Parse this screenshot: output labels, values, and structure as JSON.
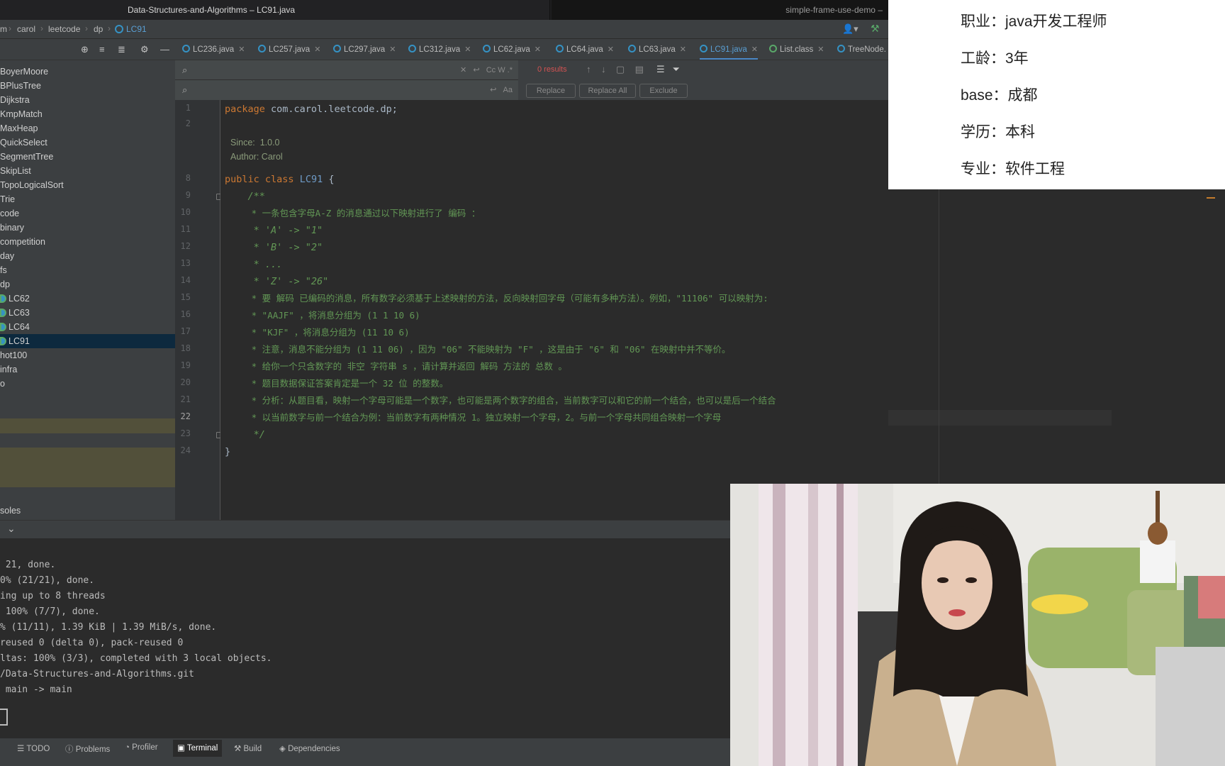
{
  "window": {
    "title_left": "Data-Structures-and-Algorithms – LC91.java",
    "title_right": "simple-frame-use-demo –"
  },
  "breadcrumb": [
    "m",
    "carol",
    "leetcode",
    "dp",
    "LC91"
  ],
  "tabs": [
    {
      "label": "LC236.java",
      "icon": "class-icon"
    },
    {
      "label": "LC257.java",
      "icon": "class-icon"
    },
    {
      "label": "LC297.java",
      "icon": "class-icon"
    },
    {
      "label": "LC312.java",
      "icon": "class-icon"
    },
    {
      "label": "LC62.java",
      "icon": "class-icon"
    },
    {
      "label": "LC64.java",
      "icon": "class-icon"
    },
    {
      "label": "LC63.java",
      "icon": "class-icon"
    },
    {
      "label": "LC91.java",
      "icon": "class-icon",
      "active": true
    },
    {
      "label": "List.class",
      "icon": "interface-icon"
    },
    {
      "label": "TreeNode.",
      "icon": "class-icon"
    }
  ],
  "find": {
    "results": "0 results",
    "options": "Cc  W  .*",
    "replace_label": "Replace",
    "replace_all_label": "Replace All",
    "exclude_label": "Exclude"
  },
  "project_tree": [
    "BoyerMoore",
    "BPlusTree",
    "Dijkstra",
    "KmpMatch",
    "MaxHeap",
    "QuickSelect",
    "SegmentTree",
    "SkipList",
    "TopoLogicalSort",
    "Trie",
    "code",
    "binary",
    "competition",
    "day",
    "fs",
    "dp",
    "LC62",
    "LC63",
    "LC64",
    "LC91",
    "hot100",
    "infra",
    "o"
  ],
  "project_consoles": "soles",
  "line_numbers": [
    "1",
    "2",
    "8",
    "9",
    "10",
    "11",
    "12",
    "13",
    "14",
    "15",
    "16",
    "17",
    "18",
    "19",
    "20",
    "21",
    "22",
    "23",
    "24"
  ],
  "code": {
    "line1_kw": "package",
    "line1_rest": " com.carol.leetcode.dp;",
    "since_label": "Since:",
    "since_value": "1.0.0",
    "author_label": "Author:",
    "author_value": "Carol",
    "line8_kw1": "public",
    "line8_kw2": "class",
    "line8_cls": "LC91",
    "line8_brace": "{",
    "line9": "    /**",
    "line10": "     * 一条包含字母A-Z 的消息通过以下映射进行了 编码 ：",
    "line11": "     * 'A' -> \"1\"",
    "line12": "     * 'B' -> \"2\"",
    "line13": "     * ...",
    "line14": "     * 'Z' -> \"26\"",
    "line15": "     * 要 解码 已编码的消息，所有数字必须基于上述映射的方法，反向映射回字母（可能有多种方法）。例如，\"11106\" 可以映射为:",
    "line16": "     * \"AAJF\" ，将消息分组为 (1 1 10 6)",
    "line17": "     * \"KJF\" ，将消息分组为 (11 10 6)",
    "line18": "     * 注意，消息不能分组为 (1 11 06) ，因为 \"06\" 不能映射为 \"F\" ，这是由于 \"6\" 和 \"06\" 在映射中并不等价。",
    "line19": "     * 给你一个只含数字的 非空 字符串 s ，请计算并返回 解码 方法的 总数 。",
    "line20": "     * 题目数据保证答案肯定是一个 32 位 的整数。",
    "line21": "     * 分析：从题目看，映射一个字母可能是一个数字，也可能是两个数字的组合，当前数字可以和它的前一个结合，也可以是后一个结合",
    "line22": "     * 以当前数字与前一个结合为例：当前数字有两种情况 1。独立映射一个字母，2。与前一个字母共同组合映射一个字母",
    "line23": "     */",
    "line24": "}"
  },
  "terminal": {
    "lines": [
      " 21, done.",
      "0% (21/21), done.",
      "ing up to 8 threads",
      " 100% (7/7), done.",
      "% (11/11), 1.39 KiB | 1.39 MiB/s, done.",
      "reused 0 (delta 0), pack-reused 0",
      "ltas: 100% (3/3), completed with 3 local objects.",
      "/Data-Structures-and-Algorithms.git",
      " main -> main"
    ]
  },
  "statusbar": {
    "todo": "TODO",
    "problems": "Problems",
    "profiler": "Profiler",
    "terminal": "Terminal",
    "build": "Build",
    "dependencies": "Dependencies"
  },
  "info_card": {
    "job": "职业：java开发工程师",
    "years": "工龄：3年",
    "base": "base：成都",
    "education": "学历：本科",
    "major": "专业：软件工程"
  },
  "colors": {
    "keyword": "#cc7832",
    "doc_comment": "#629755",
    "active_tab": "#5a9fd4",
    "results_red": "#d25252"
  }
}
